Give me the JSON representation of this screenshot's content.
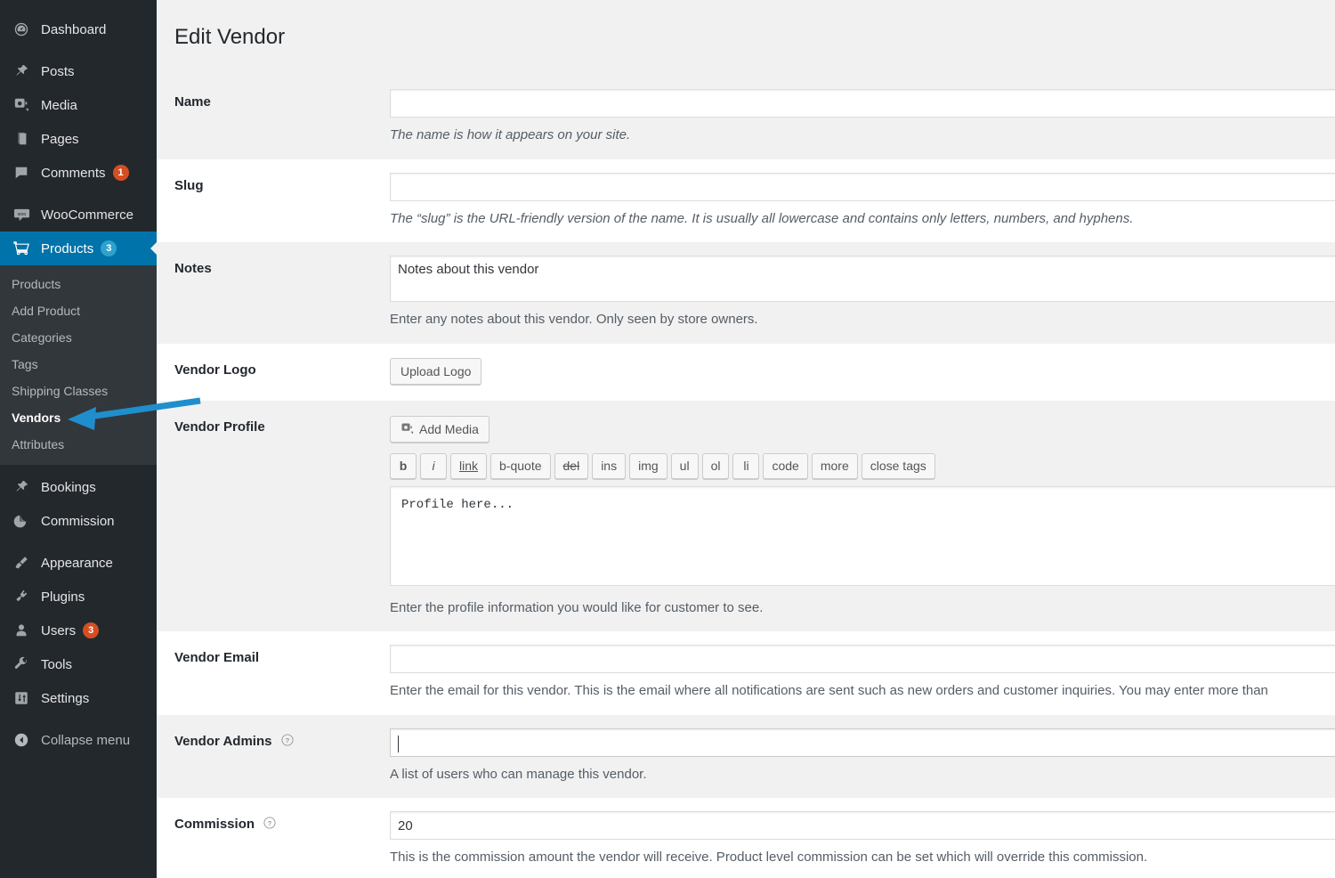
{
  "sidebar": {
    "items": [
      {
        "label": "Dashboard",
        "icon": "dashboard-icon",
        "badge": null,
        "current": false,
        "group": 0
      },
      {
        "label": "Posts",
        "icon": "pin-icon",
        "badge": null,
        "current": false,
        "group": 1
      },
      {
        "label": "Media",
        "icon": "media-icon",
        "badge": null,
        "current": false,
        "group": 1
      },
      {
        "label": "Pages",
        "icon": "pages-icon",
        "badge": null,
        "current": false,
        "group": 1
      },
      {
        "label": "Comments",
        "icon": "comment-icon",
        "badge": "1",
        "current": false,
        "group": 1
      },
      {
        "label": "WooCommerce",
        "icon": "woocommerce-icon",
        "badge": null,
        "current": false,
        "group": 2
      },
      {
        "label": "Products",
        "icon": "cart-icon",
        "badge": "3",
        "current": true,
        "group": 2
      }
    ],
    "submenu": [
      {
        "label": "Products",
        "current": false
      },
      {
        "label": "Add Product",
        "current": false
      },
      {
        "label": "Categories",
        "current": false
      },
      {
        "label": "Tags",
        "current": false
      },
      {
        "label": "Shipping Classes",
        "current": false
      },
      {
        "label": "Vendors",
        "current": true
      },
      {
        "label": "Attributes",
        "current": false
      }
    ],
    "items_after": [
      {
        "label": "Bookings",
        "icon": "pin-icon",
        "badge": null,
        "group": 3
      },
      {
        "label": "Commission",
        "icon": "pie-chart-icon",
        "badge": null,
        "group": 3
      },
      {
        "label": "Appearance",
        "icon": "paintbrush-icon",
        "badge": null,
        "group": 4
      },
      {
        "label": "Plugins",
        "icon": "plug-icon",
        "badge": null,
        "group": 4
      },
      {
        "label": "Users",
        "icon": "user-icon",
        "badge": "3",
        "group": 4
      },
      {
        "label": "Tools",
        "icon": "wrench-icon",
        "badge": null,
        "group": 4
      },
      {
        "label": "Settings",
        "icon": "settings-icon",
        "badge": null,
        "group": 4
      }
    ],
    "collapse": {
      "label": "Collapse menu",
      "icon": "collapse-arrow-icon"
    }
  },
  "page": {
    "title": "Edit Vendor"
  },
  "fields": {
    "name": {
      "label": "Name",
      "value": "",
      "description": "The name is how it appears on your site."
    },
    "slug": {
      "label": "Slug",
      "value": "",
      "description": "The “slug” is the URL-friendly version of the name. It is usually all lowercase and contains only letters, numbers, and hyphens."
    },
    "notes": {
      "label": "Notes",
      "value": "Notes about this vendor",
      "description": "Enter any notes about this vendor. Only seen by store owners."
    },
    "vendor_logo": {
      "label": "Vendor Logo",
      "button_label": "Upload Logo"
    },
    "vendor_profile": {
      "label": "Vendor Profile",
      "add_media_label": "Add Media",
      "toolbar": [
        {
          "label": "b",
          "style": "b"
        },
        {
          "label": "i",
          "style": "i"
        },
        {
          "label": "link",
          "style": "u"
        },
        {
          "label": "b-quote",
          "style": ""
        },
        {
          "label": "del",
          "style": "s"
        },
        {
          "label": "ins",
          "style": ""
        },
        {
          "label": "img",
          "style": ""
        },
        {
          "label": "ul",
          "style": ""
        },
        {
          "label": "ol",
          "style": ""
        },
        {
          "label": "li",
          "style": ""
        },
        {
          "label": "code",
          "style": ""
        },
        {
          "label": "more",
          "style": ""
        },
        {
          "label": "close tags",
          "style": ""
        }
      ],
      "value": "Profile here...",
      "description": "Enter the profile information you would like for customer to see."
    },
    "vendor_email": {
      "label": "Vendor Email",
      "value": "",
      "description": "Enter the email for this vendor. This is the email where all notifications are sent such as new orders and customer inquiries. You may enter more than"
    },
    "vendor_admins": {
      "label": "Vendor Admins",
      "help": "help-icon",
      "value": "",
      "description": "A list of users who can manage this vendor."
    },
    "commission": {
      "label": "Commission",
      "help": "help-icon",
      "value": "20",
      "description": "This is the commission amount the vendor will receive. Product level commission can be set which will override this commission."
    }
  },
  "annotation": {
    "arrow_color": "#1f8ecd",
    "points_to": "sidebar-item-vendors"
  },
  "colors": {
    "sidebar_bg": "#23282d",
    "submenu_bg": "#32373c",
    "accent": "#0073aa",
    "badge_orange": "#d54e21",
    "badge_blue": "#2ea2cc",
    "page_bg": "#f1f1f1"
  }
}
